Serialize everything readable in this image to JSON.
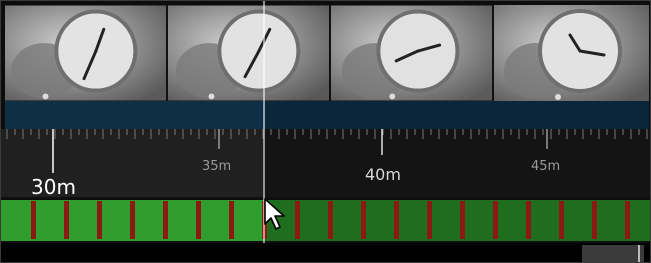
{
  "timeline": {
    "ruler_labels": {
      "l30": "30m",
      "l35": "35m",
      "l40": "40m",
      "l45": "45m"
    },
    "thumbnails": [
      {
        "name": "thumbnail-1"
      },
      {
        "name": "thumbnail-2"
      },
      {
        "name": "thumbnail-3"
      },
      {
        "name": "thumbnail-4"
      }
    ],
    "colors": {
      "track_played": "#2f9e2f",
      "track_unplayed": "#1f6e1f",
      "marker": "#8b1a12",
      "strip": "#0e2f45"
    }
  }
}
